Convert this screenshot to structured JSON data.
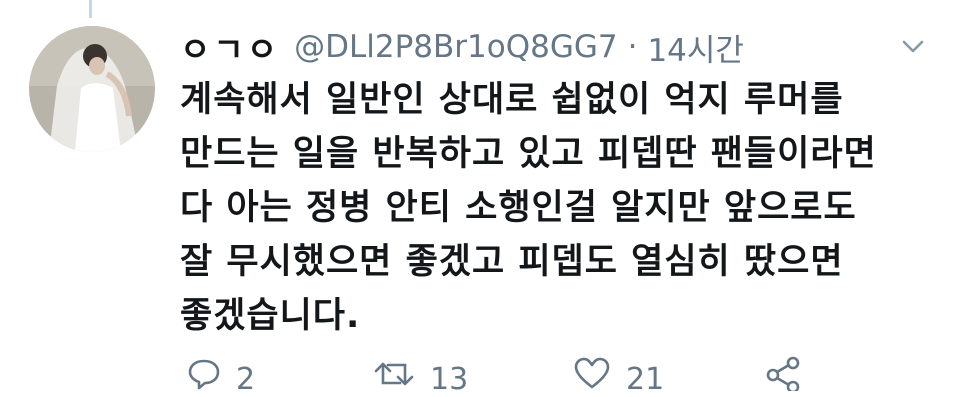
{
  "tweet": {
    "display_name": "ㅇㄱㅇ",
    "handle": "@DLl2P8Br1oQ8GG7",
    "separator": "·",
    "timestamp": "14시간",
    "text_lines": [
      "계속해서 일반인 상대로 쉽없이 억지 루머를",
      "만드는 일을 반복하고 있고 피뎁딴 팬들이라면",
      "다 아는 정병 안티 소행인걸 알지만 앞으로도",
      "잘 무시했으면 좋겠고 피뎁도 열심히 땄으면",
      "좋겠습니다."
    ]
  },
  "actions": {
    "reply_count": "2",
    "retweet_count": "13",
    "like_count": "21"
  },
  "icons": {
    "reply": "reply-icon",
    "retweet": "retweet-icon",
    "like": "heart-icon",
    "share": "share-icon",
    "menu": "chevron-down-icon"
  },
  "colors": {
    "text": "#14171a",
    "secondary": "#657786",
    "thread_line": "#ccd6dd"
  }
}
